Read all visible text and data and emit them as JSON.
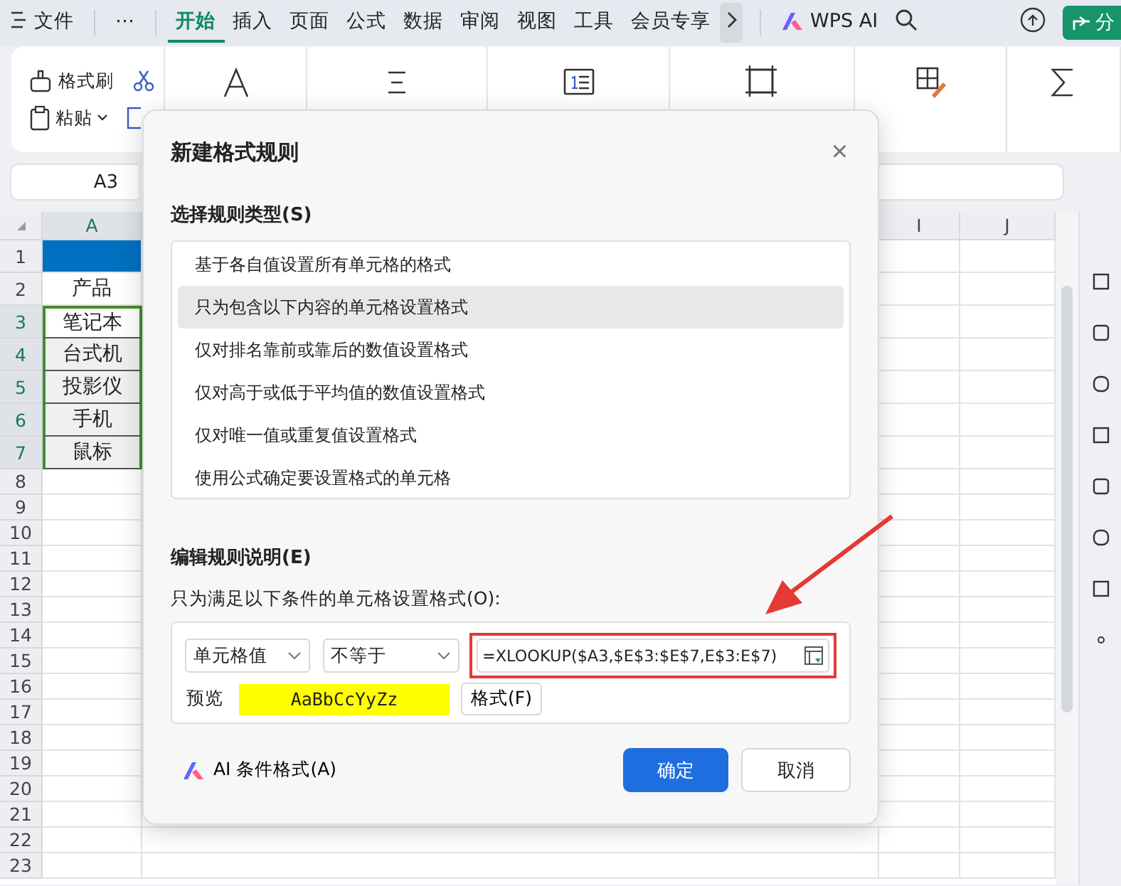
{
  "menu_bar": {
    "file_label": "文件",
    "more_label": "⋯",
    "tabs": [
      {
        "label": "开始",
        "selected": true
      },
      {
        "label": "插入",
        "selected": false
      },
      {
        "label": "页面",
        "selected": false
      },
      {
        "label": "公式",
        "selected": false
      },
      {
        "label": "数据",
        "selected": false
      },
      {
        "label": "审阅",
        "selected": false
      },
      {
        "label": "视图",
        "selected": false
      },
      {
        "label": "工具",
        "selected": false
      },
      {
        "label": "会员专享",
        "selected": false
      }
    ],
    "ai_label": "WPS AI",
    "share_label": "分"
  },
  "ribbon": {
    "format_painter": "格式刷",
    "paste": "粘贴"
  },
  "name_box": "A3",
  "sheet": {
    "columns": [
      {
        "label": "A",
        "selected": true
      },
      {
        "label": "I",
        "selected": false
      },
      {
        "label": "J",
        "selected": false
      }
    ],
    "rows": [
      {
        "number": "1",
        "cell": "",
        "kind": "header-fill",
        "selected": false
      },
      {
        "number": "2",
        "cell": "产品",
        "kind": "plain",
        "selected": false
      },
      {
        "number": "3",
        "cell": "笔记本",
        "kind": "active",
        "selected": true
      },
      {
        "number": "4",
        "cell": "台式机",
        "kind": "range",
        "selected": true
      },
      {
        "number": "5",
        "cell": "投影仪",
        "kind": "range",
        "selected": true
      },
      {
        "number": "6",
        "cell": "手机",
        "kind": "range",
        "selected": true
      },
      {
        "number": "7",
        "cell": "鼠标",
        "kind": "range",
        "selected": true
      },
      {
        "number": "8",
        "kind": "plain",
        "selected": false
      },
      {
        "number": "9",
        "kind": "plain",
        "selected": false
      },
      {
        "number": "10",
        "kind": "plain",
        "selected": false
      },
      {
        "number": "11",
        "kind": "plain",
        "selected": false
      },
      {
        "number": "12",
        "kind": "plain",
        "selected": false
      },
      {
        "number": "13",
        "kind": "plain",
        "selected": false
      },
      {
        "number": "14",
        "kind": "plain",
        "selected": false
      },
      {
        "number": "15",
        "kind": "plain",
        "selected": false
      },
      {
        "number": "16",
        "kind": "plain",
        "selected": false
      },
      {
        "number": "17",
        "kind": "plain",
        "selected": false
      },
      {
        "number": "18",
        "kind": "plain",
        "selected": false
      },
      {
        "number": "19",
        "kind": "plain",
        "selected": false
      },
      {
        "number": "20",
        "kind": "plain",
        "selected": false
      },
      {
        "number": "21",
        "kind": "plain",
        "selected": false
      },
      {
        "number": "22",
        "kind": "plain",
        "selected": false
      },
      {
        "number": "23",
        "kind": "plain",
        "selected": false
      }
    ]
  },
  "dialog": {
    "title": "新建格式规则",
    "close": "×",
    "rule_type_heading": "选择规则类型(S)",
    "rule_types": [
      {
        "label": "基于各自值设置所有单元格的格式",
        "selected": false
      },
      {
        "label": "只为包含以下内容的单元格设置格式",
        "selected": true
      },
      {
        "label": "仅对排名靠前或靠后的数值设置格式",
        "selected": false
      },
      {
        "label": "仅对高于或低于平均值的数值设置格式",
        "selected": false
      },
      {
        "label": "仅对唯一值或重复值设置格式",
        "selected": false
      },
      {
        "label": "使用公式确定要设置格式的单元格",
        "selected": false
      }
    ],
    "description_heading": "编辑规则说明(E)",
    "condition_label": "只为满足以下条件的单元格设置格式(O):",
    "value_dropdown": "单元格值",
    "operator_dropdown": "不等于",
    "formula": "=XLOOKUP($A3,$E$3:$E$7,E$3:E$7)",
    "preview_label": "预览",
    "preview_sample": "AaBbCcYyZz",
    "format_button": "格式(F)",
    "ai_button": "AI 条件格式(A)",
    "ok_button": "确定",
    "cancel_button": "取消"
  }
}
